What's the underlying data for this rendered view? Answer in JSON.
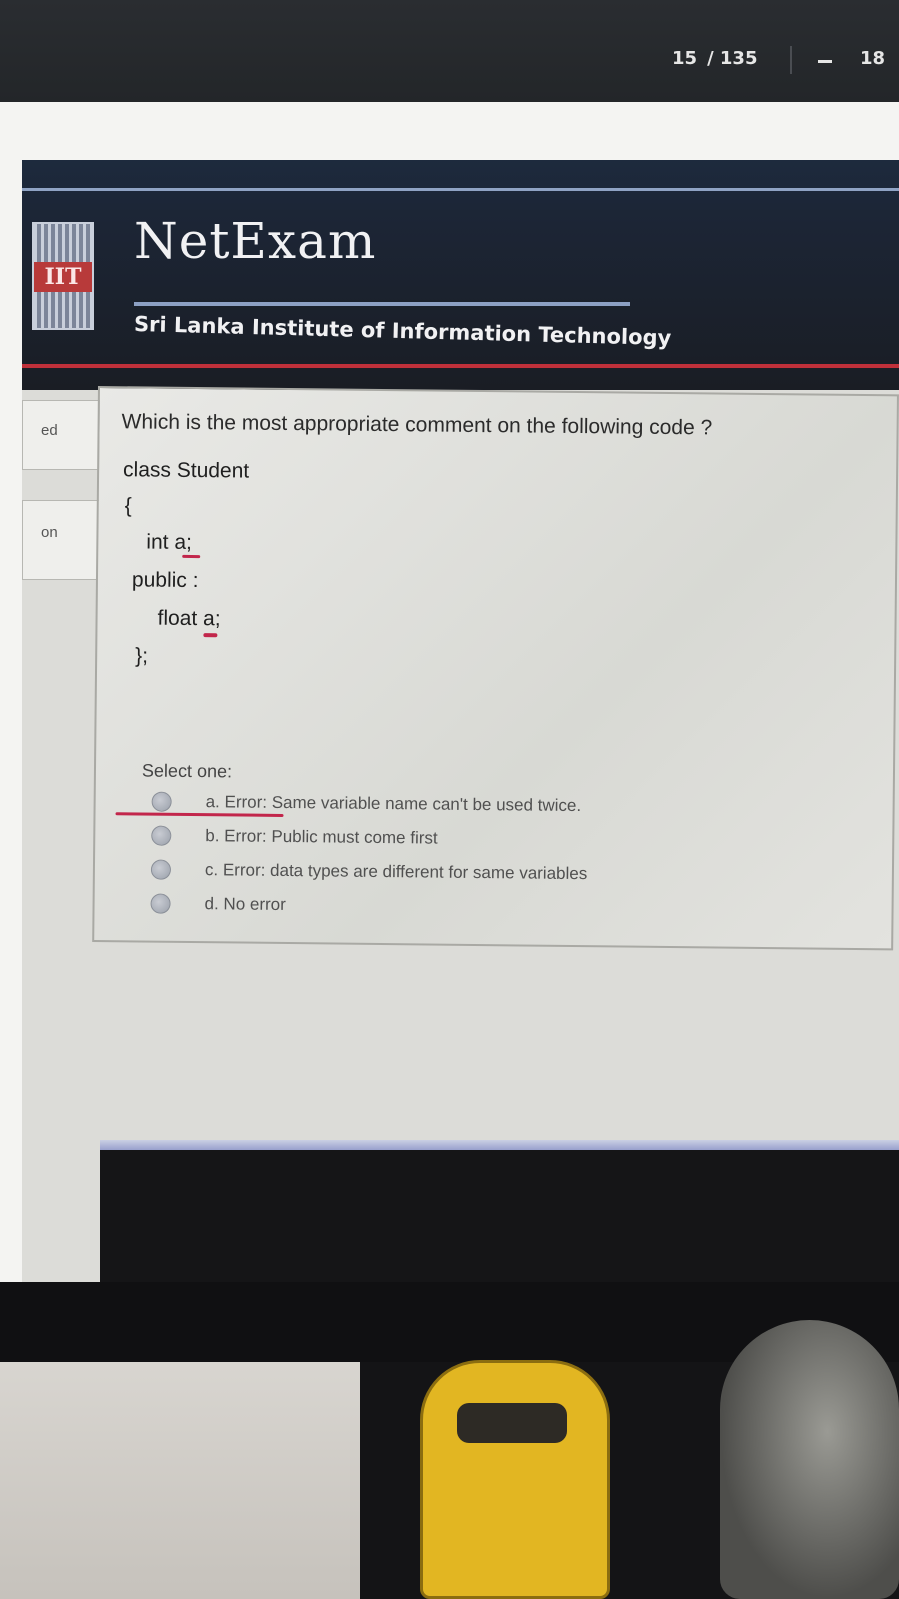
{
  "viewer": {
    "current_page": "15",
    "total_pages": "/ 135",
    "zoom_partial": "18"
  },
  "header": {
    "logo_text": "IIT",
    "title": "NetExam",
    "subtitle": "Sri Lanka Institute of Information Technology"
  },
  "sidebar": {
    "items": [
      {
        "label": "ed"
      },
      {
        "label": "on"
      }
    ]
  },
  "question": {
    "prompt": "Which is the most appropriate comment on the following code ?",
    "code_lines": [
      "class Student",
      "{",
      "int a;",
      "public :",
      "float a;",
      "};"
    ],
    "select_label": "Select one:",
    "options": [
      {
        "label": "a. Error: Same variable name can't be used twice."
      },
      {
        "label": "b. Error: Public must come first"
      },
      {
        "label": "c. Error: data types are different for same variables"
      },
      {
        "label": "d. No error"
      }
    ]
  },
  "colors": {
    "header_bg": "#1a1d24",
    "accent_red": "#c0303a",
    "accent_blue": "#8da0c4",
    "ink": "#c2264b"
  }
}
